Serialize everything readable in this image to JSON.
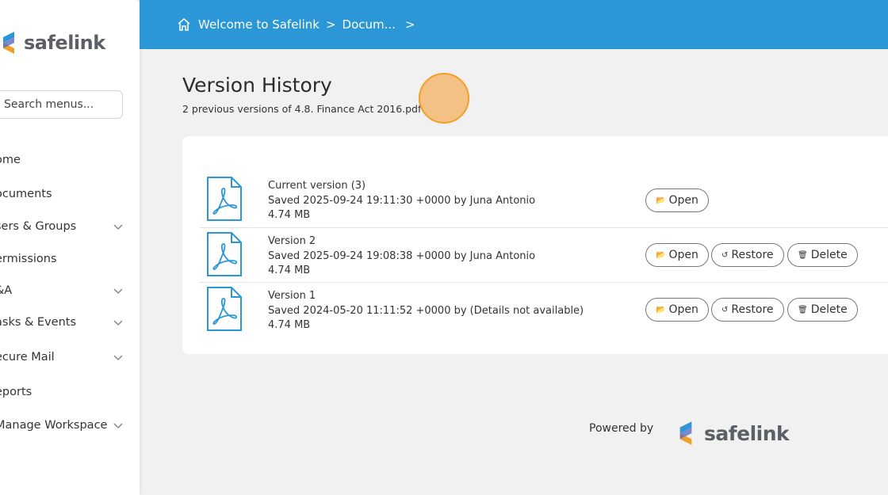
{
  "brand": {
    "name": "safelink",
    "colors": {
      "blue": "#2b97d6",
      "orange": "#f0a02a"
    }
  },
  "sidebar": {
    "search_placeholder": "Search menus...",
    "items": [
      {
        "label": "Home",
        "display": "ome",
        "has_children": false
      },
      {
        "label": "Documents",
        "display": "ocuments",
        "has_children": false
      },
      {
        "label": "Users & Groups",
        "display": "sers & Groups",
        "has_children": true
      },
      {
        "label": "Permissions",
        "display": "ermissions",
        "has_children": false
      },
      {
        "label": "Q&A",
        "display": "&A",
        "has_children": true
      },
      {
        "label": "Tasks & Events",
        "display": "asks & Events",
        "has_children": true
      },
      {
        "label": "Secure Mail",
        "display": "ecure Mail",
        "has_children": true
      },
      {
        "label": "Reports",
        "display": "eports",
        "has_children": false
      },
      {
        "label": "Manage Workspace",
        "display": "Manage Workspace",
        "has_children": true
      }
    ]
  },
  "topbar": {
    "breadcrumb": [
      "Welcome to Safelink",
      "Docum..."
    ],
    "separator": ">"
  },
  "page": {
    "title": "Version History",
    "subtitle": "2 previous versions of 4.8. Finance Act 2016.pdf"
  },
  "versions": [
    {
      "label": "Current version (3)",
      "saved": "Saved 2025-09-24 19:11:30 +0000 by Juna Antonio",
      "size": "4.74 MB",
      "actions": [
        "Open"
      ]
    },
    {
      "label": "Version 2",
      "saved": "Saved 2025-09-24 19:08:38 +0000 by Juna Antonio",
      "size": "4.74 MB",
      "actions": [
        "Open",
        "Restore",
        "Delete"
      ]
    },
    {
      "label": "Version 1",
      "saved": "Saved 2024-05-20 11:11:52 +0000 by (Details not available)",
      "size": "4.74 MB",
      "actions": [
        "Open",
        "Restore",
        "Delete"
      ]
    }
  ],
  "buttons": {
    "open": "Open",
    "restore": "Restore",
    "delete": "Delete"
  },
  "footer": {
    "powered_by": "Powered by",
    "logo_text": "safelink"
  }
}
